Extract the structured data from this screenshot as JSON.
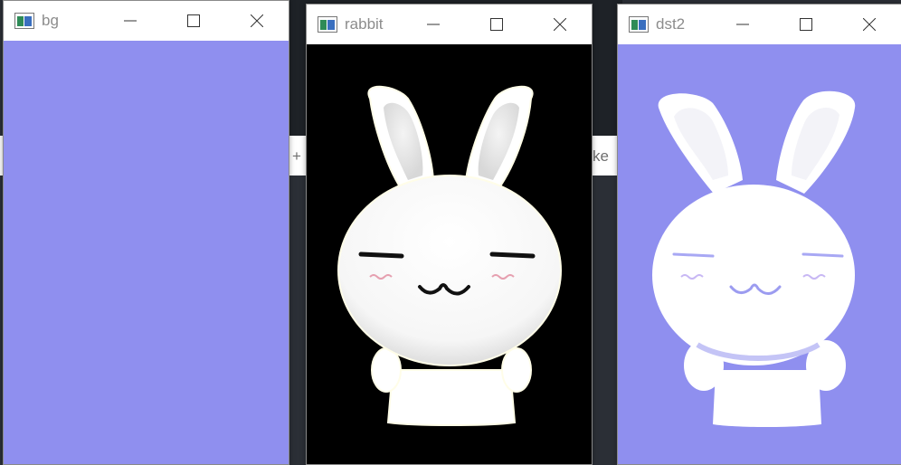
{
  "windows": [
    {
      "title": "bg",
      "content": "solid-fill",
      "fill": "#8f8fef"
    },
    {
      "title": "rabbit",
      "content": "rabbit-on-black",
      "fill": "#000000"
    },
    {
      "title": "dst2",
      "content": "rabbit-on-purple",
      "fill": "#8f8fef"
    }
  ],
  "background": {
    "partial_text_left": "+",
    "partial_text_right": "ke"
  },
  "colors": {
    "purple": "#8f8fef",
    "title_text": "#8c8c8c",
    "icon": [
      "#2e8b57",
      "#3a6fbf"
    ]
  },
  "icons": [
    "app-image-icon",
    "minimize-icon",
    "maximize-icon",
    "close-icon"
  ]
}
